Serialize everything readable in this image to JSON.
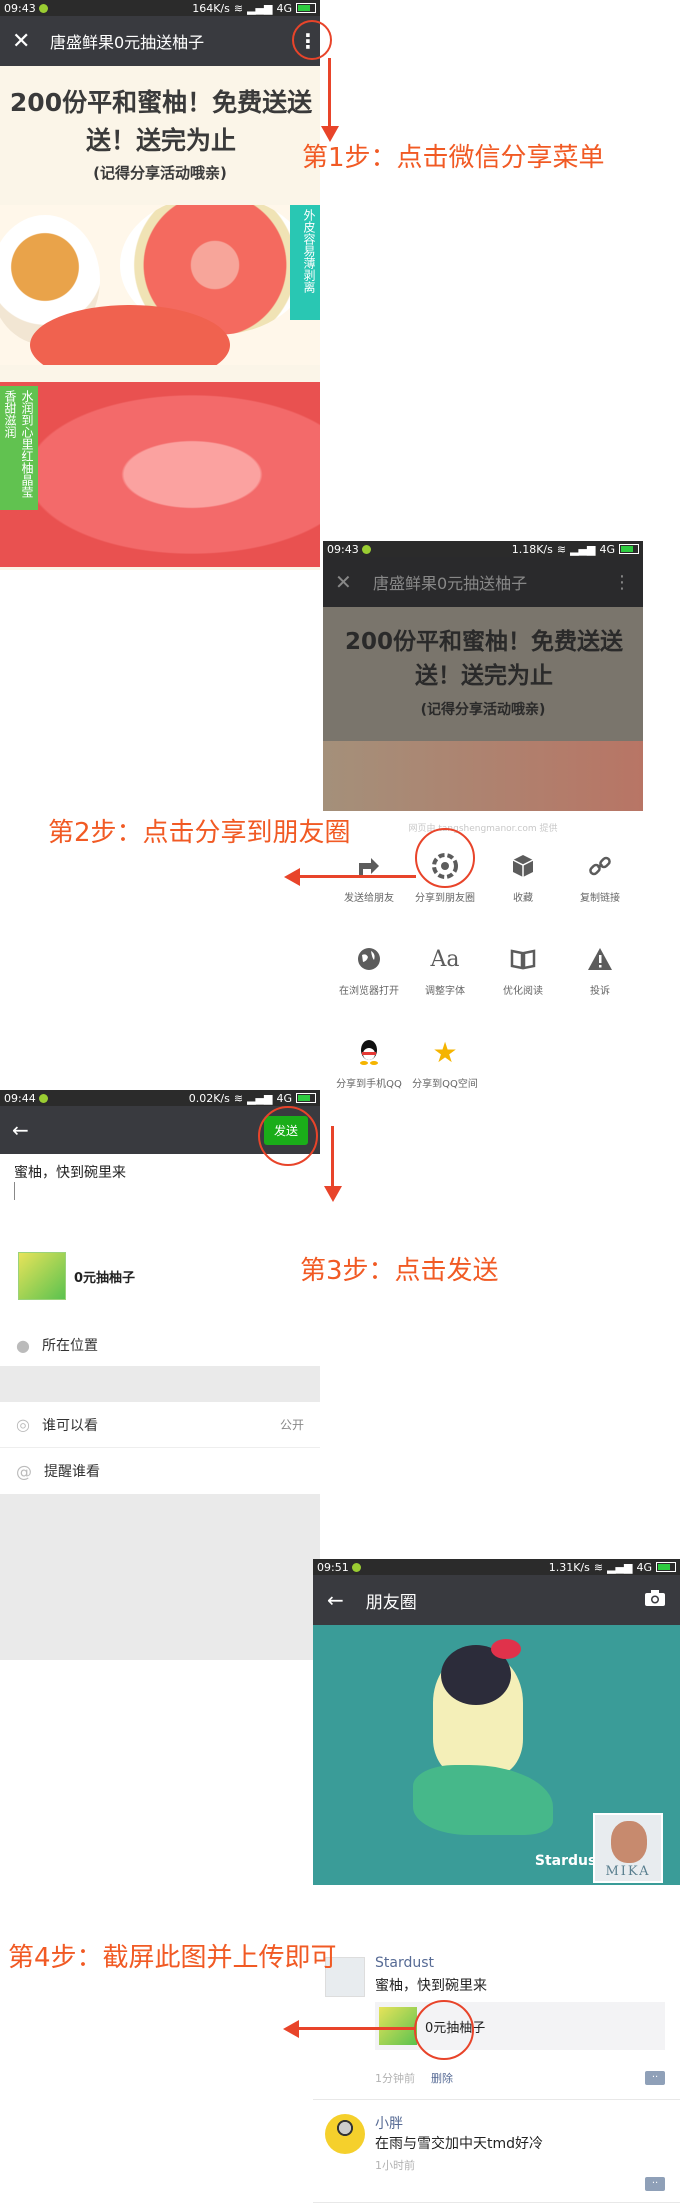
{
  "steps": {
    "s1": "第1步：点击微信分享菜单",
    "s2": "第2步：点击分享到朋友圈",
    "s3": "第3步：点击发送",
    "s4": "第4步：截屏此图并上传即可"
  },
  "screen1": {
    "status_time": "09:43",
    "status_right": "164K/s",
    "network": "4G",
    "title": "唐盛鲜果0元抽送柚子",
    "headline": "200份平和蜜柚！免费送送送！送完为止",
    "subline": "(记得分享活动哦亲)",
    "badge1": "外皮容易薄剥离",
    "badge2": "水润到心里红柚晶莹香甜滋润"
  },
  "screen2": {
    "status_time": "09:43",
    "status_right": "1.18K/s",
    "network": "4G",
    "title": "唐盛鲜果0元抽送柚子",
    "headline": "200份平和蜜柚！免费送送送！送完为止",
    "subline": "(记得分享活动哦亲)",
    "source_hint": "网页由 tangshengmanor.com 提供",
    "share_items": [
      {
        "label": "发送给朋友",
        "icon": "forward-icon"
      },
      {
        "label": "分享到朋友圈",
        "icon": "moments-icon"
      },
      {
        "label": "收藏",
        "icon": "cube-icon"
      },
      {
        "label": "复制链接",
        "icon": "link-icon"
      },
      {
        "label": "在浏览器打开",
        "icon": "globe-icon"
      },
      {
        "label": "调整字体",
        "icon": "font-icon"
      },
      {
        "label": "优化阅读",
        "icon": "book-icon"
      },
      {
        "label": "投诉",
        "icon": "warning-icon"
      },
      {
        "label": "分享到手机QQ",
        "icon": "qq-icon"
      },
      {
        "label": "分享到QQ空间",
        "icon": "qzone-icon"
      }
    ]
  },
  "screen3": {
    "status_time": "09:44",
    "status_right": "0.02K/s",
    "network": "4G",
    "send_label": "发送",
    "post_text": "蜜柚，快到碗里来",
    "link_title": "0元抽柚子",
    "location_label": "所在位置",
    "visibility_label": "谁可以看",
    "visibility_value": "公开",
    "mention_label": "提醒谁看"
  },
  "screen4": {
    "status_time": "09:51",
    "status_right": "1.31K/s",
    "network": "4G",
    "title": "朋友圈",
    "cover_name": "Stardust",
    "avatar_text": "MIKA",
    "post1": {
      "author": "Stardust",
      "text": "蜜柚，快到碗里来",
      "link": "0元抽柚子",
      "time": "1分钟前",
      "delete": "删除"
    },
    "post2": {
      "author": "小胖",
      "text": "在雨与雪交加中天tmd好冷",
      "time": "1小时前"
    }
  },
  "colors": {
    "accent": "#e8442a",
    "step_text": "#f15a24",
    "wechat_green": "#1aad19",
    "bar_dark": "#393a3f",
    "teal_cover": "#3a9c98"
  }
}
